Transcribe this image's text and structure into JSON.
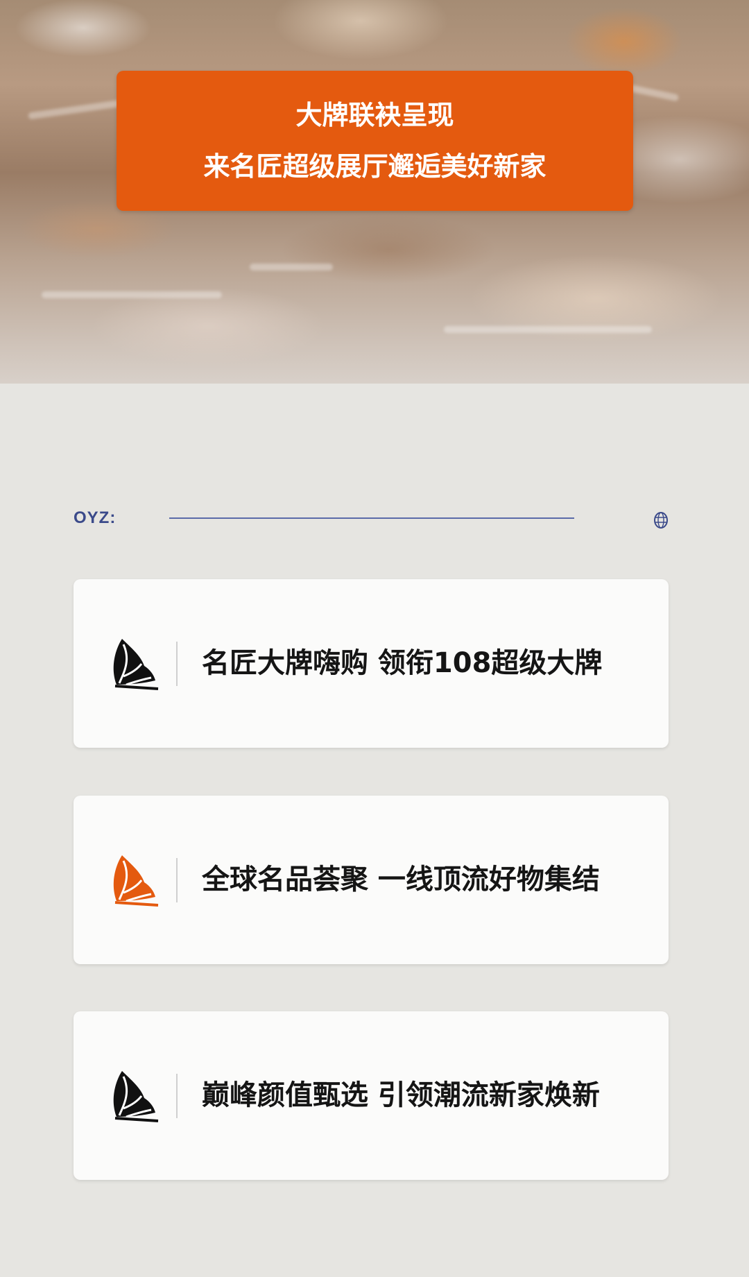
{
  "banner": {
    "line1": "大牌联袂呈现",
    "line2": "来名匠超级展厅邂逅美好新家"
  },
  "section": {
    "label": "OYZ:",
    "icon": "globe-icon"
  },
  "cards": [
    {
      "text": "名匠大牌嗨购  领衔108超级大牌",
      "icon": "leaf-icon",
      "icon_color": "#111111"
    },
    {
      "text": "全球名品荟聚  一线顶流好物集结",
      "icon": "leaf-icon",
      "icon_color": "#e45a0f"
    },
    {
      "text": "巅峰颜值甄选  引领潮流新家焕新",
      "icon": "leaf-icon",
      "icon_color": "#111111"
    }
  ],
  "colors": {
    "accent": "#e45a0f",
    "line": "#5a6aa8",
    "background": "#e6e5e1"
  }
}
